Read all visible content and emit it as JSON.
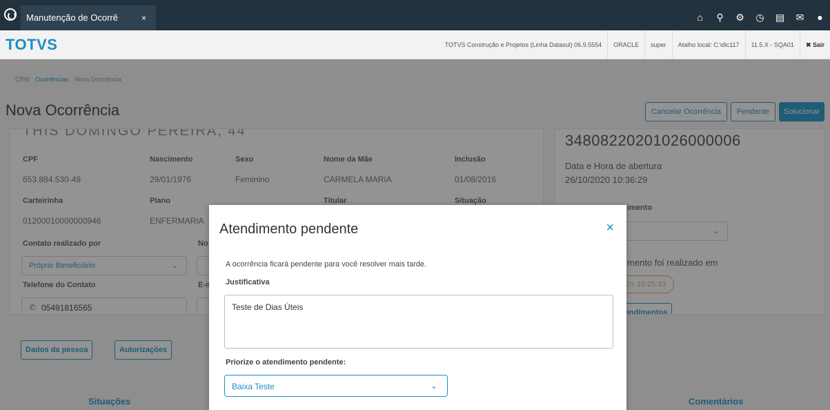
{
  "topbar": {
    "tab_label": "Manutenção de Ocorrê",
    "tab_close": "×",
    "icons": [
      "home-icon",
      "sitemap-icon",
      "gear-icon",
      "help-icon",
      "document-icon",
      "mail-icon",
      "info-icon"
    ],
    "icon_glyphs": [
      "⌂",
      "⚲",
      "⚙",
      "◷",
      "▤",
      "✉",
      "●"
    ]
  },
  "brandbar": {
    "brand": "TOTVS",
    "company": "TOTVS Construção e Projetos (Linha Datasul) 06.9.5554",
    "database": "ORACLE",
    "user": "super",
    "shortcut": "Atalho local: C:\\dlc117",
    "version": "11.5.X - SQA01",
    "exit": "✖ Sair"
  },
  "breadcrumb": {
    "root": "CRM",
    "link": "Ocorrências",
    "current": "Nova Ocorrência"
  },
  "page": {
    "title": "Nova Ocorrência",
    "cancel_button": "Cancelar Ocorrência",
    "pending_button": "Pendente",
    "solve_button": "Solucionar"
  },
  "beneficiary": {
    "name_partial": "THIS DOMINGO PEREIRA, 44",
    "cpf_label": "CPF",
    "cpf": "653.884.530-49",
    "birth_label": "Nascimento",
    "birth": "29/01/1976",
    "sex_label": "Sexo",
    "sex": "Feminino",
    "mother_label": "Nome da Mãe",
    "mother": "CARMELA MARIA",
    "inclusion_label": "Inclusão",
    "inclusion": "01/08/2016",
    "card_label": "Carteirinha",
    "card": "01200010000000946",
    "plan_label": "Plano",
    "plan": "ENFERMARIA",
    "holder_label": "Titular",
    "status_label": "Situação",
    "contact_by_label": "Contato realizado por",
    "contact_by": "Próprio Beneficiário",
    "name_label_partial": "No",
    "phone_label": "Telefone do Contato",
    "phone": "05491816565",
    "email_label_partial": "E-m",
    "person_button": "Dados da pessoa",
    "auth_button": "Autorizações"
  },
  "protocol_card": {
    "number": "34808220201026000006",
    "opened_label": "Data e Hora de abertura",
    "opened": "26/10/2020 10:36:29",
    "service_label_partial": "imento",
    "realized_label_partial": "mento foi realizado em",
    "realized_pill": "2's 10:25:33",
    "services_button_partial": "tendimentos"
  },
  "sections": {
    "left": "Situações",
    "right": "Comentários"
  },
  "modal": {
    "title": "Atendimento pendente",
    "close": "×",
    "description": "A ocorrência ficará pendente para você resolver mais tarde.",
    "justification_label": "Justificativa",
    "justification_value": "Teste de Dias Úteis",
    "priority_label": "Priorize o atendimento pendente:",
    "priority_value": "Baixa Teste"
  },
  "colors": {
    "accent": "#1a8fc4",
    "topbar": "#23323f",
    "warning_pill": "#c9a86a"
  }
}
